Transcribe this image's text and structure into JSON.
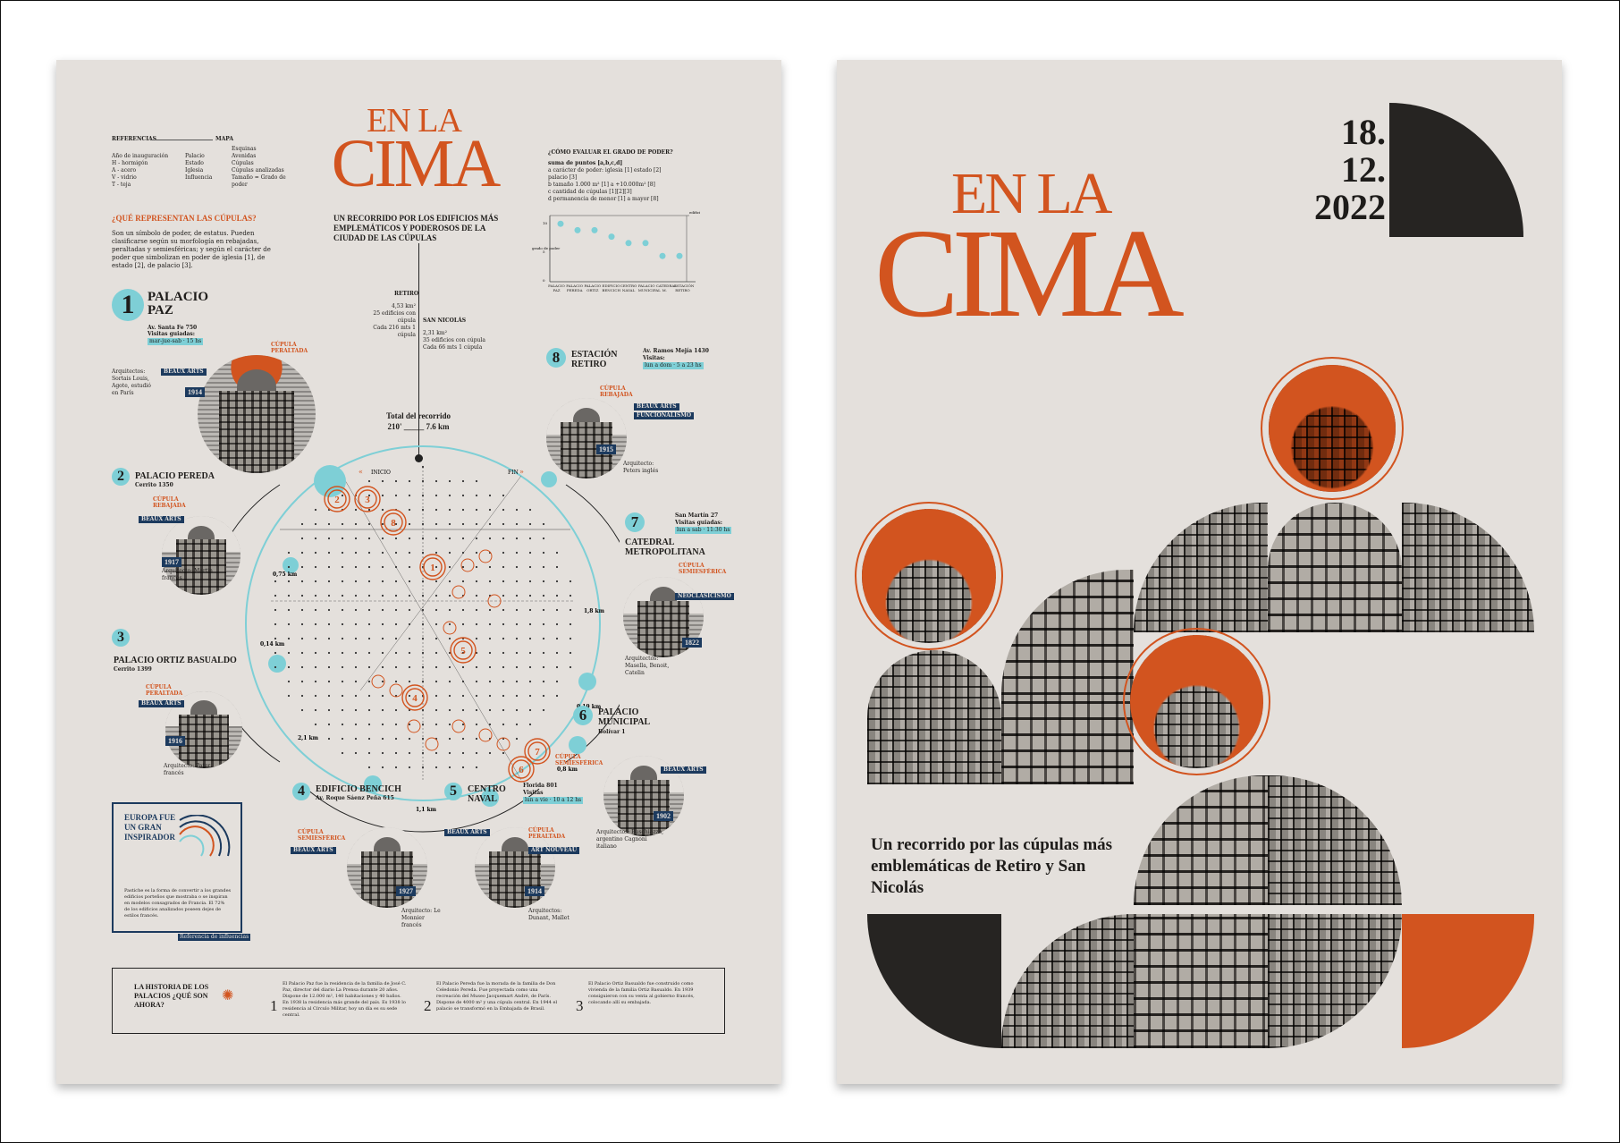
{
  "poster1": {
    "title_line1": "EN LA",
    "title_line2": "CIMA",
    "subtitle": "UN RECORRIDO POR LOS EDIFICIOS MÁS EMPLEMÁTICOS Y PODEROSOS DE LA CIUDAD DE LAS CÚPULAS",
    "references": {
      "header_left": "REFERENCIAS",
      "header_right": "MAPA",
      "col1": [
        "Año de inauguración",
        "H - hormigón",
        "A - acero",
        "V - vidrio",
        "T - teja"
      ],
      "col2": [
        "Palacio",
        "Estado",
        "Iglesia",
        "Influencia"
      ],
      "col3": [
        "Esquinas",
        "Avenidas",
        "Cúpulas",
        "Cúpulas analizadas",
        "Tamaño = Grado de poder"
      ]
    },
    "question": {
      "title": "¿QUÉ REPRESENTAN LAS CÚPULAS?",
      "text": "Son un símbolo de poder, de estatus. Pueden clasificarse según su morfología en rebajadas, peraltadas y semiesféricas; y según el carácter de poder que simbolizan en poder de iglesia [1], de estado [2], de palacio [3]."
    },
    "power": {
      "title": "¿CÓMO EVALUAR EL GRADO DE PODER?",
      "lines": [
        "suma de puntos [a,b,c,d]",
        "a carácter de poder: iglesia [1] estado [2] palacio [3]",
        "b tamaño 1.000 m² [1] a +10.000m² [8]",
        "c cantidad de cúpulas [1][2][3]",
        "d permanencia de menor [1] a mayor [8]"
      ],
      "y_label": "grado de poder",
      "x_label": "edificio",
      "y_ticks": [
        "10",
        "5",
        "0"
      ],
      "buildings": [
        "PALACIO PAZ",
        "PALACIO PEREDA",
        "PALACIO ORTIZ",
        "EDIFICIO BENCICH",
        "CENTRO NAVAL",
        "PALACIO MUNICIPAL",
        "CATEDRAL M.",
        "ESTACIÓN RETIRO"
      ],
      "values": [
        9,
        8,
        8,
        7,
        6,
        6,
        4,
        4
      ]
    },
    "route": {
      "retiro_label": "RETIRO",
      "retiro_text": [
        "4,53 km²",
        "25 edificios con cúpula",
        "Cada 216 mts 1 cúpula"
      ],
      "sannicolas_label": "SAN NICOLÁS",
      "sannicolas_text": [
        "2,31 km²",
        "35 edificios con cúpula",
        "Cada 66 mts 1 cúpula"
      ],
      "total_label": "Total del recorrido",
      "total_value": "210' _____ 7.6 km",
      "inicio": "INICIO",
      "fin": "FIN",
      "distances": [
        "0,75 km",
        "0,14 km",
        "2,1 km",
        "1,1 km",
        "0,8 km",
        "0,19 km",
        "1,8 km"
      ]
    },
    "buildings": [
      {
        "num": "1",
        "name": "PALACIO PAZ",
        "address": "Av. Santa Fe 750",
        "visits": "Visitas guiadas:",
        "hours": "mar-jue-sab · 15 hs",
        "dome": "CÚPULA PERALTADA",
        "style": "BEAUX ARTS",
        "year": "1914",
        "architect": "Arquitectos: Sortais Louis, Agote, estudió en París"
      },
      {
        "num": "2",
        "name": "PALACIO PEREDA",
        "address": "Cerrito 1350",
        "dome": "CÚPULA REBAJADA",
        "style": "BEAUX ARTS",
        "year": "1917",
        "architect": "Arquitecto: Martin francés"
      },
      {
        "num": "3",
        "name": "PALACIO ORTIZ BASUALDO",
        "address": "Cerrito 1399",
        "dome": "CÚPULA PERALTADA",
        "style": "BEAUX ARTS",
        "year": "1916",
        "architect": "Arquitecto: Pater francés"
      },
      {
        "num": "4",
        "name": "EDIFICIO BENCICH",
        "address": "Av. Roque Sáenz Peña 615",
        "dome": "CÚPULA SEMIESFÉRICA",
        "style": "BEAUX ARTS",
        "year": "1927",
        "architect": "Arquitecto: Le Monnier francés"
      },
      {
        "num": "5",
        "name": "CENTRO NAVAL",
        "address": "Florida 801",
        "visits": "Visitas",
        "hours": "lun a vie · 10 a 12 hs",
        "dome": "CÚPULA PERALTADA",
        "style": "BEAUX ARTS",
        "style2": "ART NOUVEAU",
        "year": "1914",
        "architect": "Arquitectos: Dunant, Mallet"
      },
      {
        "num": "6",
        "name": "PALACIO MUNICIPAL",
        "address": "Bolívar 1",
        "dome": "CÚPULA SEMIESFÉRICA",
        "style": "BEAUX ARTS",
        "year": "1902",
        "architect": "Arquitectos: Buschiazzo, argentino Cagnoni italiano"
      },
      {
        "num": "7",
        "name": "CATEDRAL METROPOLITANA",
        "address": "San Martín 27",
        "visits": "Visitas guiadas:",
        "hours": "lun a sab · 11:30 hs",
        "dome": "CÚPULA SEMIESFÉRICA",
        "style": "NEOCLASICISMO",
        "year": "1822",
        "architect": "Arquitectos: Masella, Benoit, Catelin"
      },
      {
        "num": "8",
        "name": "ESTACIÓN RETIRO",
        "address": "Av. Ramos Mejía 1430",
        "visits": "Visitas:",
        "hours": "lun a dom · 5 a 23 hs",
        "dome": "CÚPULA REBAJADA",
        "style": "BEAUX ARTS",
        "style2": "FUNCIONALISMO",
        "year": "1915",
        "architect": "Arquitecto: Peters inglés"
      }
    ],
    "europe": {
      "title": "EUROPA FUE UN GRAN INSPIRADOR",
      "text": "Pastiche es la forma de convertir a los grandes edificios porteños que mostraba o se inspiran en modelos consagrados de Francia. El 72% de los edificios analizados poseen dejes de estilos francés.",
      "footer": "Referencia de influencias"
    },
    "history": {
      "title": "LA HISTORIA DE LOS PALACIOS ¿QUÉ SON AHORA?",
      "items": [
        {
          "num": "1",
          "text": "El Palacio Paz fue la residencia de la familia de José C. Paz, director del diario La Prensa durante 20 años. Dispone de 12.000 m², 140 habitaciones y 40 baños. En 1938 la residencia más grande del país. Es 1938 lo residencia al Círculo Militar, hoy un día es su sede central."
        },
        {
          "num": "2",
          "text": "El Palacio Pereda fue la morada de la familia de Don Celedonio Pereda. Fue proyectada como una recreación del Museo Jacquemart André, de París. Dispone de 4000 m² y una cúpula central. En 1944 el palacio se transformó en la Embajada de Brasil."
        },
        {
          "num": "3",
          "text": "El Palacio Ortiz Basualdo fue construido como vivienda de la familia Ortiz Basualdo. En 1939 consiguieron con su venta al gobierno francés, colocando allí su embajada."
        }
      ]
    }
  },
  "poster2": {
    "title_line1": "EN LA",
    "title_line2": "CIMA",
    "date": [
      "18.",
      "12.",
      "2022"
    ],
    "tagline": "Un recorrido por las cúpulas más emblemáticas de Retiro y San Nicolás"
  },
  "colors": {
    "orange": "#d2541f",
    "teal": "#7ecfd6",
    "navy": "#1c3a5e",
    "dark": "#262422",
    "paper": "#e4e0dc"
  }
}
